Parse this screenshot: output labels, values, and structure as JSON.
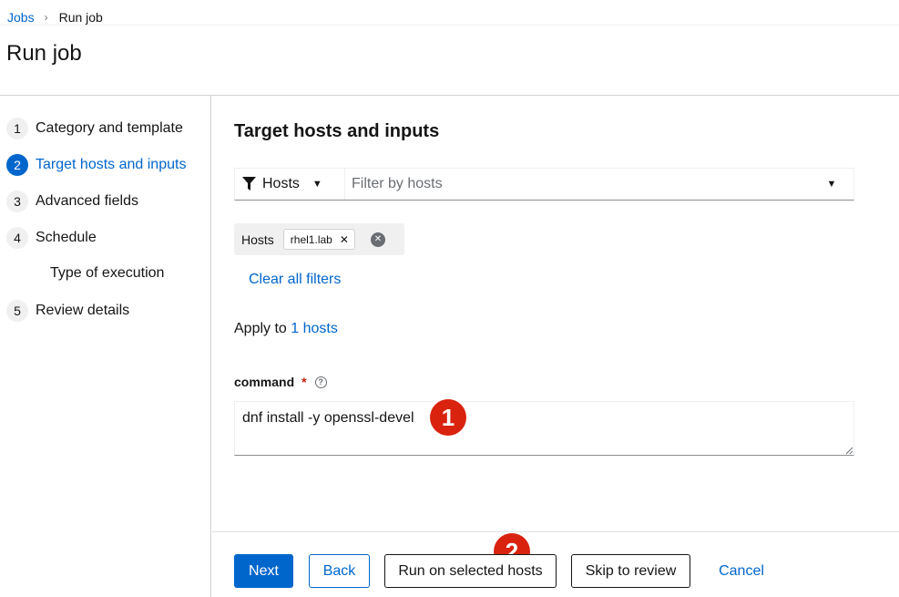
{
  "breadcrumb": {
    "parent": "Jobs",
    "separator": "›",
    "current": "Run job"
  },
  "page_title": "Run job",
  "nav": {
    "items": [
      {
        "num": "1",
        "label": "Category and template"
      },
      {
        "num": "2",
        "label": "Target hosts and inputs"
      },
      {
        "num": "3",
        "label": "Advanced fields"
      },
      {
        "num": "4",
        "label": "Schedule"
      },
      {
        "num": "5",
        "label": "Review details"
      }
    ],
    "sub_item": "Type of execution",
    "active_index": 1
  },
  "section_title": "Target hosts and inputs",
  "filter": {
    "type_label": "Hosts",
    "placeholder": "Filter by hosts",
    "chip_category": "Hosts",
    "chip_value": "rhel1.lab",
    "clear_all": "Clear all filters"
  },
  "apply": {
    "prefix": "Apply to ",
    "link": "1 hosts"
  },
  "command": {
    "label": "command",
    "required_mark": "*",
    "value": "dnf install -y openssl-devel"
  },
  "annotations": {
    "badge1": "1",
    "badge2": "2"
  },
  "footer": {
    "next": "Next",
    "back": "Back",
    "run": "Run on selected hosts",
    "skip": "Skip to review",
    "cancel": "Cancel"
  },
  "colors": {
    "primary": "#0066cc",
    "badge": "#d9230f",
    "required": "#c9190b"
  }
}
